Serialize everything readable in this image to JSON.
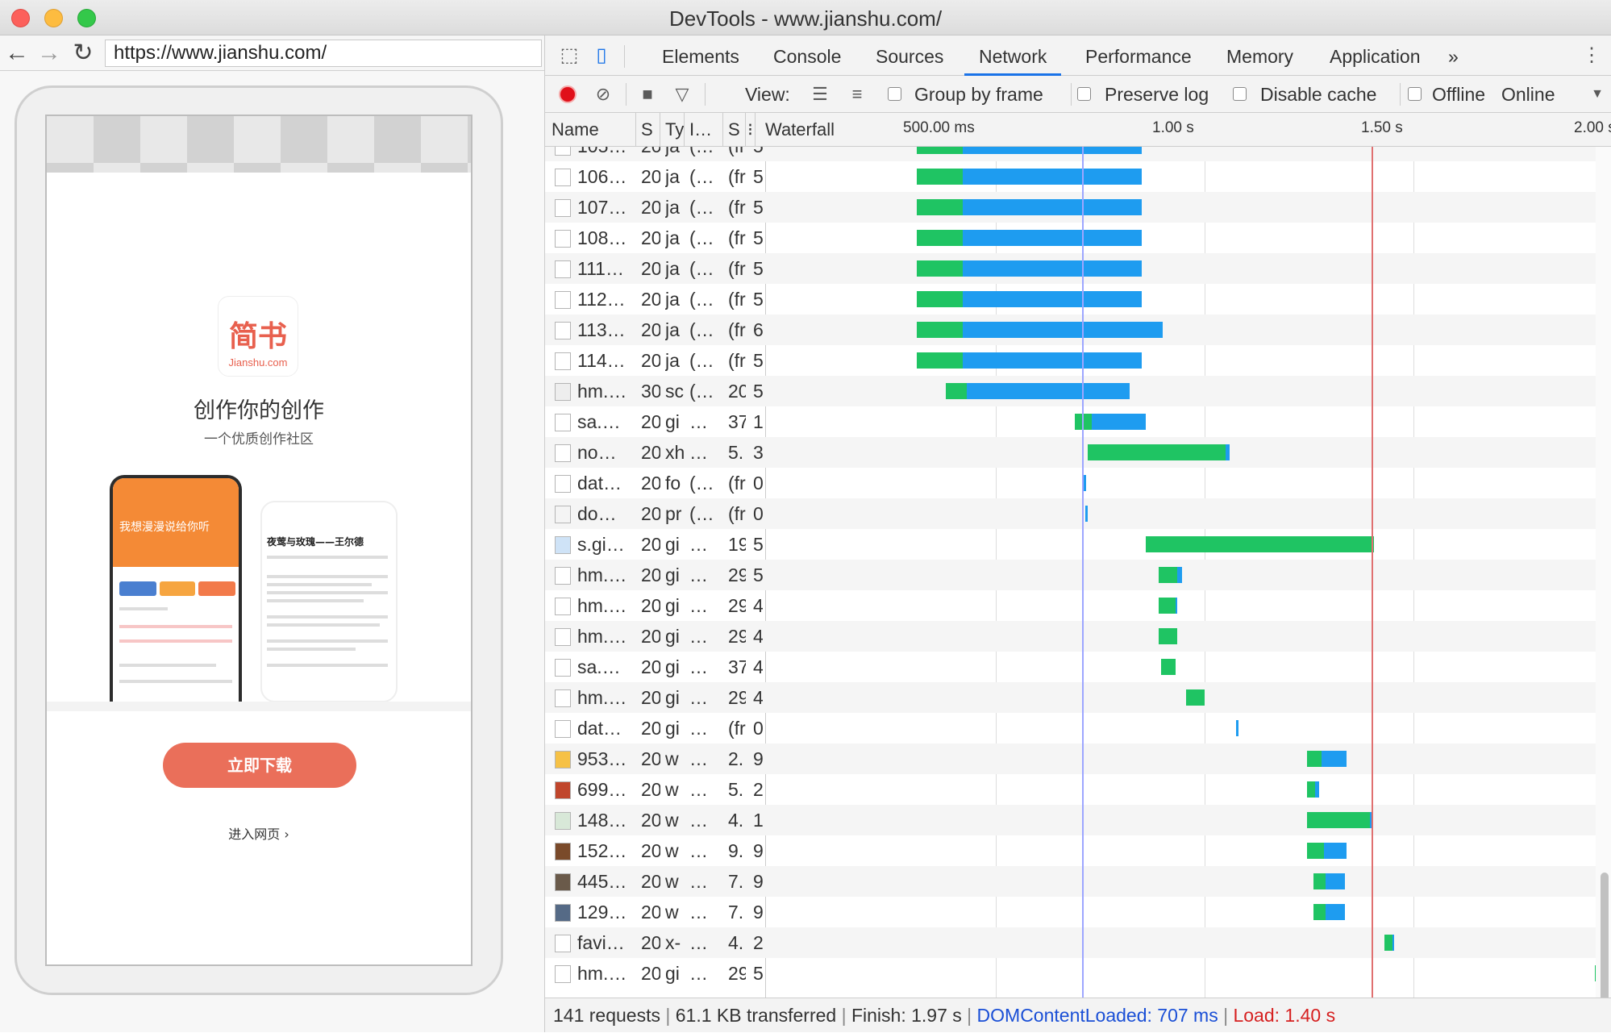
{
  "window": {
    "title": "DevTools - www.jianshu.com/"
  },
  "browser": {
    "url": "https://www.jianshu.com/"
  },
  "page": {
    "logo_text": "简书",
    "logo_sub": "Jianshu.com",
    "slogan": "创作你的创作",
    "subtitle": "一个优质创作社区",
    "banner_text": "我想漫漫说给你听",
    "article_title": "夜莺与玫瑰——王尔德",
    "download_button": "立即下载",
    "web_link": "进入网页 ›"
  },
  "devtools": {
    "tabs": [
      "Elements",
      "Console",
      "Sources",
      "Network",
      "Performance",
      "Memory",
      "Application",
      "»"
    ],
    "active_tab": "Network",
    "toolbar": {
      "view_label": "View:",
      "group_by_frame": "Group by frame",
      "preserve_log": "Preserve log",
      "disable_cache": "Disable cache",
      "offline": "Offline",
      "online": "Online"
    },
    "columns": {
      "name": "Name",
      "status": "S",
      "type": "Ty",
      "initiator": "I…",
      "size": "S",
      "waterfall": "Waterfall"
    },
    "ticks": [
      "500.00 ms",
      "1.00 s",
      "1.50 s",
      "2.00 s"
    ],
    "status_bar": {
      "requests": "141 requests",
      "transferred": "61.1 KB transferred",
      "finish": "Finish: 1.97 s",
      "dcl": "DOMContentLoaded: 707 ms",
      "load": "Load: 1.40 s",
      "sep": "|"
    }
  },
  "network_rows": [
    {
      "name": "105…",
      "status": "20",
      "type": "ja",
      "init": "(…",
      "size": "(fr",
      "t": "5",
      "icon": "doc",
      "start": 0.31,
      "wait": 0.11,
      "dl": 0.43
    },
    {
      "name": "106…",
      "status": "20",
      "type": "ja",
      "init": "(…",
      "size": "(fr",
      "t": "5",
      "icon": "doc",
      "start": 0.31,
      "wait": 0.11,
      "dl": 0.43
    },
    {
      "name": "107…",
      "status": "20",
      "type": "ja",
      "init": "(…",
      "size": "(fr",
      "t": "5",
      "icon": "doc",
      "start": 0.31,
      "wait": 0.11,
      "dl": 0.43
    },
    {
      "name": "108…",
      "status": "20",
      "type": "ja",
      "init": "(…",
      "size": "(fr",
      "t": "5",
      "icon": "doc",
      "start": 0.31,
      "wait": 0.11,
      "dl": 0.43
    },
    {
      "name": "111…",
      "status": "20",
      "type": "ja",
      "init": "(…",
      "size": "(fr",
      "t": "5",
      "icon": "doc",
      "start": 0.31,
      "wait": 0.11,
      "dl": 0.43
    },
    {
      "name": "112…",
      "status": "20",
      "type": "ja",
      "init": "(…",
      "size": "(fr",
      "t": "5",
      "icon": "doc",
      "start": 0.31,
      "wait": 0.11,
      "dl": 0.43
    },
    {
      "name": "113…",
      "status": "20",
      "type": "ja",
      "init": "(…",
      "size": "(fr",
      "t": "6",
      "icon": "doc",
      "start": 0.31,
      "wait": 0.11,
      "dl": 0.48
    },
    {
      "name": "114…",
      "status": "20",
      "type": "ja",
      "init": "(…",
      "size": "(fr",
      "t": "5",
      "icon": "doc",
      "start": 0.31,
      "wait": 0.11,
      "dl": 0.43
    },
    {
      "name": "hm.…",
      "status": "30",
      "type": "sc",
      "init": "(…",
      "size": "20",
      "t": "5",
      "icon": "text",
      "start": 0.38,
      "wait": 0.05,
      "dl": 0.39
    },
    {
      "name": "sa.…",
      "status": "20",
      "type": "gi",
      "init": "…",
      "size": "37",
      "t": "1",
      "icon": "doc",
      "start": 0.69,
      "wait": 0.04,
      "dl": 0.13
    },
    {
      "name": "no…",
      "status": "20",
      "type": "xh",
      "init": "…",
      "size": "5.",
      "t": "3",
      "icon": "doc",
      "start": 0.72,
      "wait": 0.33,
      "dl": 0.01
    },
    {
      "name": "dat…",
      "status": "20",
      "type": "fo",
      "init": "(…",
      "size": "(fr",
      "t": "0",
      "icon": "doc",
      "start": 0.71,
      "wait": 0.0,
      "dl": 0.007
    },
    {
      "name": "do…",
      "status": "20",
      "type": "pr",
      "init": "(…",
      "size": "(fr",
      "t": "0",
      "icon": "img",
      "start": 0.715,
      "wait": 0.0,
      "dl": 0.007
    },
    {
      "name": "s.gi…",
      "status": "20",
      "type": "gi",
      "init": "…",
      "size": "19",
      "t": "5",
      "icon": "pic",
      "start": 0.86,
      "wait": 0.545,
      "dl": 0.0
    },
    {
      "name": "hm.…",
      "status": "20",
      "type": "gi",
      "init": "…",
      "size": "29",
      "t": "5",
      "icon": "doc",
      "start": 0.89,
      "wait": 0.045,
      "dl": 0.01
    },
    {
      "name": "hm.…",
      "status": "20",
      "type": "gi",
      "init": "…",
      "size": "29",
      "t": "4",
      "icon": "doc",
      "start": 0.89,
      "wait": 0.04,
      "dl": 0.005
    },
    {
      "name": "hm.…",
      "status": "20",
      "type": "gi",
      "init": "…",
      "size": "29",
      "t": "4",
      "icon": "doc",
      "start": 0.89,
      "wait": 0.045,
      "dl": 0.0
    },
    {
      "name": "sa.…",
      "status": "20",
      "type": "gi",
      "init": "…",
      "size": "37",
      "t": "4",
      "icon": "doc",
      "start": 0.895,
      "wait": 0.035,
      "dl": 0.0
    },
    {
      "name": "hm.…",
      "status": "20",
      "type": "gi",
      "init": "…",
      "size": "29",
      "t": "4",
      "icon": "doc",
      "start": 0.955,
      "wait": 0.045,
      "dl": 0.0
    },
    {
      "name": "dat…",
      "status": "20",
      "type": "gi",
      "init": "…",
      "size": "(fr",
      "t": "0",
      "icon": "doc",
      "start": 1.075,
      "wait": 0.0,
      "dl": 0.007
    },
    {
      "name": "953…",
      "status": "20",
      "type": "w",
      "init": "…",
      "size": "2.",
      "t": "9",
      "icon": "warn",
      "start": 1.245,
      "wait": 0.035,
      "dl": 0.06
    },
    {
      "name": "699…",
      "status": "20",
      "type": "w",
      "init": "…",
      "size": "5.",
      "t": "2",
      "icon": "pic2",
      "start": 1.245,
      "wait": 0.02,
      "dl": 0.01
    },
    {
      "name": "148…",
      "status": "20",
      "type": "w",
      "init": "…",
      "size": "4.",
      "t": "1",
      "icon": "pic3",
      "start": 1.245,
      "wait": 0.15,
      "dl": 0.004
    },
    {
      "name": "152…",
      "status": "20",
      "type": "w",
      "init": "…",
      "size": "9.",
      "t": "9",
      "icon": "pic4",
      "start": 1.245,
      "wait": 0.04,
      "dl": 0.055
    },
    {
      "name": "445…",
      "status": "20",
      "type": "w",
      "init": "…",
      "size": "7.",
      "t": "9",
      "icon": "pic5",
      "start": 1.26,
      "wait": 0.03,
      "dl": 0.045
    },
    {
      "name": "129…",
      "status": "20",
      "type": "w",
      "init": "…",
      "size": "7.",
      "t": "9",
      "icon": "pic6",
      "start": 1.26,
      "wait": 0.03,
      "dl": 0.045
    },
    {
      "name": "favi…",
      "status": "20",
      "type": "x-",
      "init": "…",
      "size": "4.",
      "t": "2",
      "icon": "doc",
      "start": 1.43,
      "wait": 0.02,
      "dl": 0.004
    },
    {
      "name": "hm.…",
      "status": "20",
      "type": "gi",
      "init": "…",
      "size": "29",
      "t": "5",
      "icon": "doc",
      "start": 1.935,
      "wait": 0.05,
      "dl": 0.0
    }
  ],
  "timeline": {
    "dcl": 0.707,
    "load": 1.4
  }
}
